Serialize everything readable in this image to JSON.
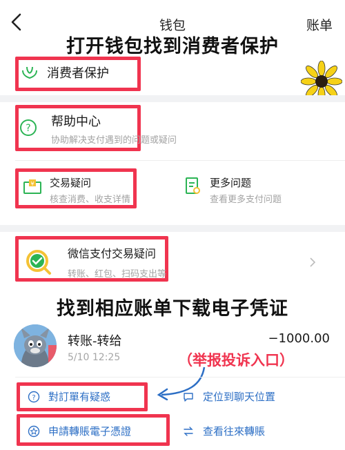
{
  "nav": {
    "back_icon": "chevron-left-icon",
    "title": "钱包",
    "right": "账单"
  },
  "overlay": {
    "title_top": "打开钱包找到消费者保护",
    "title_mid": "找到相应账单下载电子凭证",
    "report_label": "（举报投诉入口）"
  },
  "menu": {
    "consumer_protection": "消费者保护",
    "help_center": {
      "title": "帮助中心",
      "desc": "协助解决支付遇到的问题或疑问"
    },
    "trade_question": {
      "title": "交易疑问",
      "desc": "核查消费、收支详情"
    },
    "more_questions": {
      "title": "更多问题",
      "desc": "查看更多支付问题"
    },
    "wechat_pay": {
      "title": "微信支付交易疑问",
      "desc": "转账、红包、扫码支出等"
    }
  },
  "bill": {
    "title": "转账-转给",
    "amount": "−1000.00",
    "time": "5/10 12:25"
  },
  "actions": {
    "doubt": "對訂單有疑惑",
    "locate": "定位到聊天位置",
    "apply": "申請轉賬電子憑證",
    "view": "查看往來轉賬"
  },
  "colors": {
    "accent_red": "#f0344f",
    "brand_green": "#2bb454",
    "action_blue": "#2d6fc5"
  }
}
